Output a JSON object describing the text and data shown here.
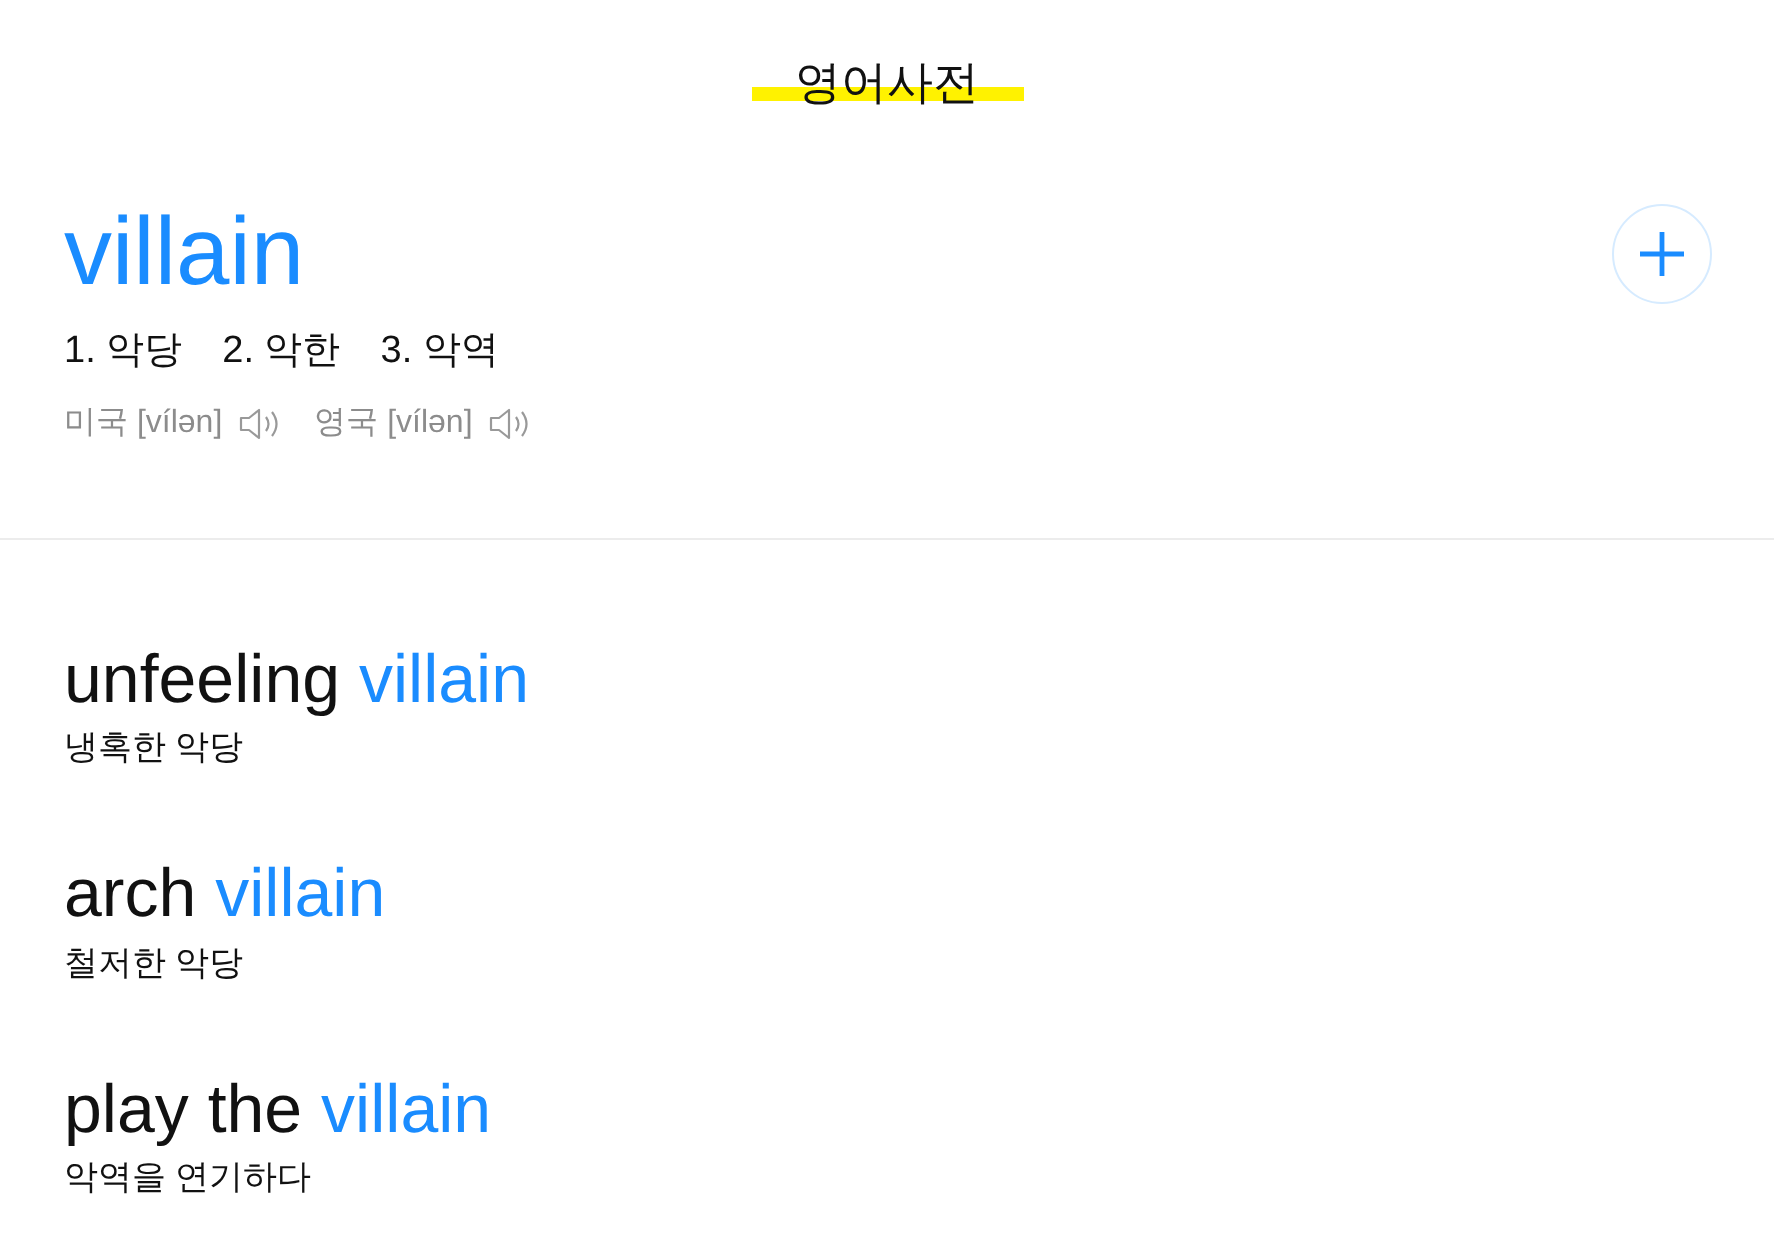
{
  "header": {
    "title": "영어사전"
  },
  "entry": {
    "headword": "villain",
    "meanings": [
      "1. 악당",
      "2. 악한",
      "3. 악역"
    ],
    "pronunciations": [
      {
        "label": "미국 [vílən]"
      },
      {
        "label": "영국 [vílən]"
      }
    ]
  },
  "examples": [
    {
      "lead": "unfeeling",
      "keyword": "villain",
      "meaning": "냉혹한 악당"
    },
    {
      "lead": "arch",
      "keyword": "villain",
      "meaning": "철저한 악당"
    },
    {
      "lead": "play the",
      "keyword": "villain",
      "meaning": "악역을 연기하다"
    }
  ]
}
